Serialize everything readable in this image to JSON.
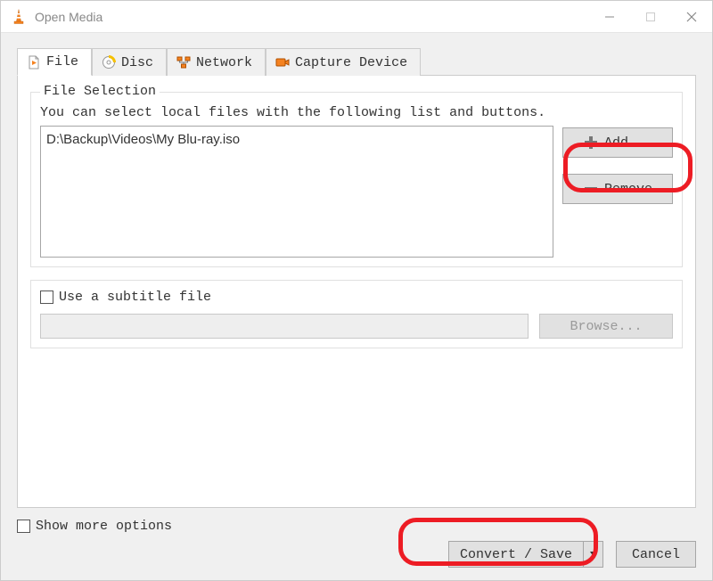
{
  "window": {
    "title": "Open Media"
  },
  "tabs": {
    "file": "File",
    "disc": "Disc",
    "network": "Network",
    "capture": "Capture Device"
  },
  "file_selection": {
    "legend": "File Selection",
    "instruction": "You can select local files with the following list and buttons.",
    "items": [
      "D:\\Backup\\Videos\\My Blu-ray.iso"
    ],
    "add_label": "Add...",
    "remove_label": "Remove"
  },
  "subtitle": {
    "use_label": "Use a subtitle file",
    "browse_label": "Browse...",
    "checked": false
  },
  "footer": {
    "show_more_label": "Show more options",
    "show_more_checked": false,
    "convert_label": "Convert / Save",
    "cancel_label": "Cancel"
  }
}
